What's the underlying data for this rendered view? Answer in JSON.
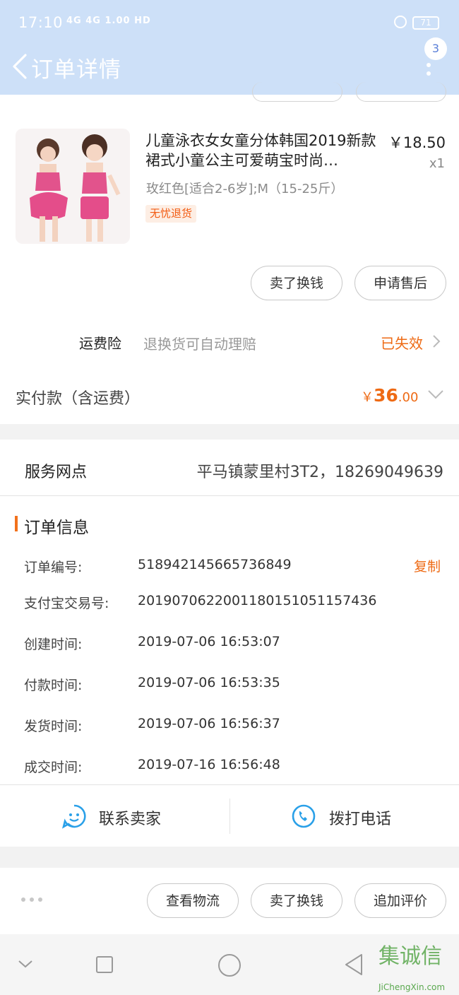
{
  "status_bar": {
    "time": "17:10",
    "signals": "4G 4G 1.00 HD",
    "battery": "71"
  },
  "header": {
    "title": "订单详情",
    "badge_count": "3"
  },
  "product": {
    "title": "儿童泳衣女女童分体韩国2019新款裙式小童公主可爱萌宝时尚…",
    "price": "￥18.50",
    "quantity": "x1",
    "sku": "玫红色[适合2-6岁];M（15-25斤）",
    "tag": "无忧退货",
    "sell_button": "卖了换钱",
    "after_sale_button": "申请售后"
  },
  "insurance": {
    "label": "运费险",
    "description": "退换货可自动理赔",
    "status": "已失效"
  },
  "payment": {
    "label": "实付款（含运费）",
    "currency": "￥",
    "amount_int": "36",
    "amount_dec": ".00"
  },
  "service": {
    "label": "服务网点",
    "value": "平马镇蒙里村3T2，18269049639"
  },
  "order_info": {
    "title": "订单信息",
    "copy": "复制",
    "rows": [
      {
        "label": "订单编号:",
        "value": "518942145665736849"
      },
      {
        "label": "支付宝交易号:",
        "value": "2019070622001180151051157436"
      },
      {
        "label": "创建时间:",
        "value": "2019-07-06 16:53:07"
      },
      {
        "label": "付款时间:",
        "value": "2019-07-06 16:53:35"
      },
      {
        "label": "发货时间:",
        "value": "2019-07-06 16:56:37"
      },
      {
        "label": "成交时间:",
        "value": "2019-07-16 16:56:48"
      }
    ]
  },
  "contact": {
    "seller": "联系卖家",
    "call": "拨打电话"
  },
  "bottom_actions": {
    "logistics": "查看物流",
    "sell": "卖了换钱",
    "review": "追加评价"
  },
  "watermark": {
    "text": "JiChengXin.com",
    "logo": "集诚信"
  },
  "colors": {
    "header_bg": "#cde0f8",
    "accent_orange": "#ee6a14",
    "icon_blue": "#2aa0e8"
  }
}
